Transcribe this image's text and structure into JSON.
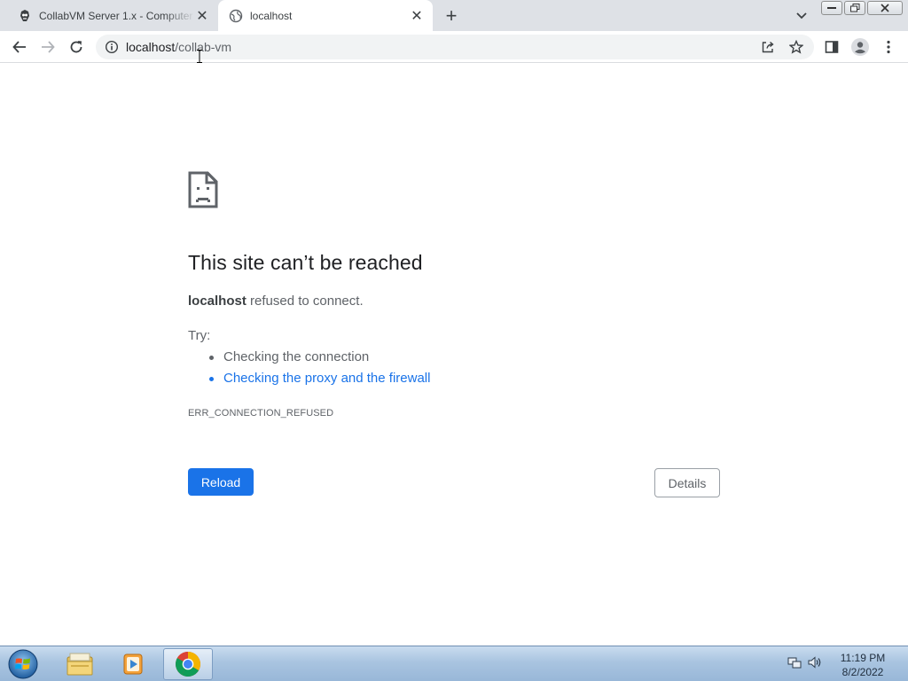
{
  "browser": {
    "tabs": [
      {
        "title": "CollabVM Server 1.x - Computer",
        "active": false,
        "favicon": "collabvm-logo-icon"
      },
      {
        "title": "localhost",
        "active": true,
        "favicon": "globe-icon"
      }
    ],
    "new_tab_label": "+",
    "address": {
      "host": "localhost",
      "path": "/collab-vm"
    }
  },
  "error_page": {
    "heading": "This site can’t be reached",
    "host": "localhost",
    "message": " refused to connect.",
    "try_label": "Try:",
    "suggestions": [
      {
        "text": "Checking the connection",
        "link": false
      },
      {
        "text": "Checking the proxy and the firewall",
        "link": true
      }
    ],
    "error_code": "ERR_CONNECTION_REFUSED",
    "reload_label": "Reload",
    "details_label": "Details"
  },
  "taskbar": {
    "apps": [
      "windows-explorer-icon",
      "media-player-icon",
      "chrome-icon"
    ],
    "active_app": "chrome-icon",
    "time": "11:19 PM",
    "date": "8/2/2022"
  },
  "colors": {
    "accent": "#1a73e8",
    "tabstrip": "#dee1e6",
    "text_primary": "#202124",
    "text_secondary": "#5f6368"
  }
}
